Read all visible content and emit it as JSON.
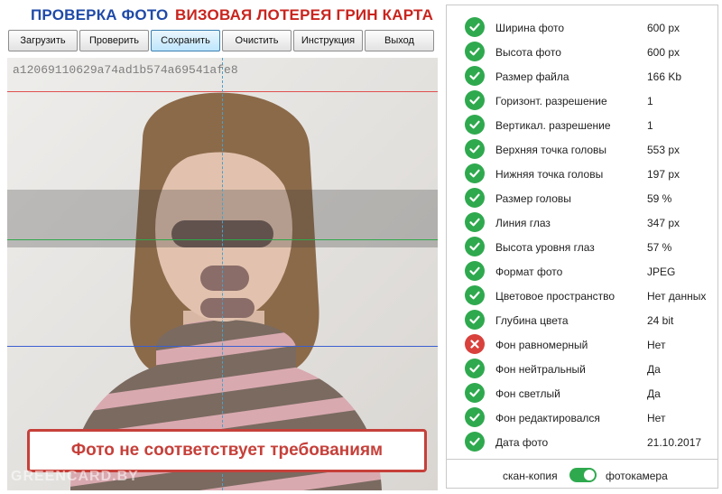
{
  "header": {
    "title_main": "ПРОВЕРКА ФОТО",
    "title_lottery": "ВИЗОВАЯ ЛОТЕРЕЯ ГРИН КАРТА"
  },
  "toolbar": {
    "buttons": [
      {
        "label": "Загрузить"
      },
      {
        "label": "Проверить"
      },
      {
        "label": "Сохранить"
      },
      {
        "label": "Очистить"
      },
      {
        "label": "Инструкция"
      },
      {
        "label": "Выход"
      }
    ]
  },
  "photo": {
    "id": "a12069110629a74ad1b574a69541afe8",
    "error_message": "Фото не соответствует требованиям",
    "watermark": "GREENCARD.BY"
  },
  "results": {
    "items": [
      {
        "label": "Ширина фото",
        "value": "600 px",
        "status": "ok"
      },
      {
        "label": "Высота фото",
        "value": "600 px",
        "status": "ok"
      },
      {
        "label": "Размер файла",
        "value": "166 Kb",
        "status": "ok"
      },
      {
        "label": "Горизонт. разрешение",
        "value": "1",
        "status": "ok"
      },
      {
        "label": "Вертикал. разрешение",
        "value": "1",
        "status": "ok"
      },
      {
        "label": "Верхняя точка головы",
        "value": "553 px",
        "status": "ok"
      },
      {
        "label": "Нижняя точка головы",
        "value": "197 px",
        "status": "ok"
      },
      {
        "label": "Размер головы",
        "value": "59 %",
        "status": "ok"
      },
      {
        "label": "Линия глаз",
        "value": "347 px",
        "status": "ok"
      },
      {
        "label": "Высота уровня глаз",
        "value": "57 %",
        "status": "ok"
      },
      {
        "label": "Формат фото",
        "value": "JPEG",
        "status": "ok"
      },
      {
        "label": "Цветовое пространство",
        "value": "Нет данных",
        "status": "ok"
      },
      {
        "label": "Глубина цвета",
        "value": "24 bit",
        "status": "ok"
      },
      {
        "label": "Фон равномерный",
        "value": "Нет",
        "status": "fail"
      },
      {
        "label": "Фон нейтральный",
        "value": "Да",
        "status": "ok"
      },
      {
        "label": "Фон светлый",
        "value": "Да",
        "status": "ok"
      },
      {
        "label": "Фон редактировался",
        "value": "Нет",
        "status": "ok"
      },
      {
        "label": "Дата фото",
        "value": "21.10.2017",
        "status": "ok"
      }
    ],
    "footer": {
      "left_label": "скан-копия",
      "right_label": "фотокамера",
      "toggle_on": true
    }
  },
  "colors": {
    "title_blue": "#1f4aa8",
    "title_red": "#c8241e",
    "ok_green": "#2fa94e",
    "fail_red": "#d8413c",
    "error_border": "#c6403a"
  }
}
